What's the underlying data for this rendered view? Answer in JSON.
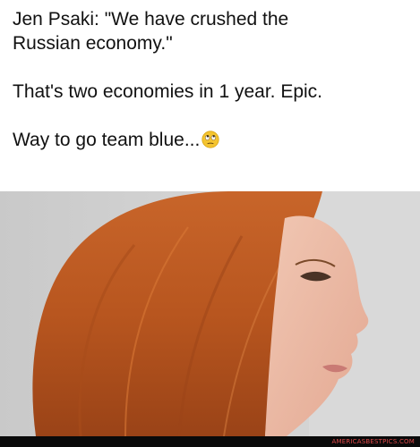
{
  "post": {
    "line1": "Jen Psaki: \"We have crushed the",
    "line2": "Russian economy.\"",
    "line3": "That's two economies in 1 year. Epic.",
    "line4": "Way to go team blue...",
    "emoji": "rolling-eyes-emoji"
  },
  "photo": {
    "subject": "woman-profile-photo",
    "hair_color": "#b8561f",
    "background_color": "#cfcfcf"
  },
  "watermark": {
    "text": "AMERICASBESTPICS.COM",
    "color": "#e24a4a"
  }
}
